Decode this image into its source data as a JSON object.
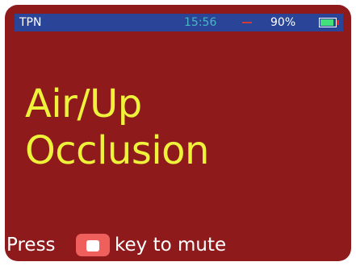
{
  "status_bar": {
    "mode": "TPN",
    "time": "15:56",
    "battery_percent": "90%",
    "battery_level": 0.9,
    "battery_icon": "battery-icon",
    "alarm_dash_icon": "alarm-dash-icon",
    "colors": {
      "background": "#2a4598",
      "time": "#47b6c4",
      "battery_fill": "#41e07b",
      "battery_cap": "#ff1a26",
      "dash": "#d23a39"
    }
  },
  "alarm": {
    "line1": "Air/Up",
    "line2": "Occlusion",
    "color": "#eef23a"
  },
  "mute_hint": {
    "prefix": "Press",
    "key_icon": "mute-key-icon",
    "suffix": "key to mute"
  },
  "colors": {
    "screen_background": "#8f1a1c",
    "mute_key": "#ef5f5c"
  }
}
